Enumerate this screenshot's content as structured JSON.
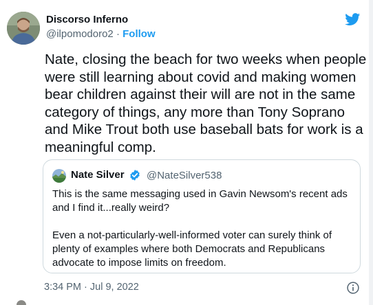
{
  "author": {
    "name": "Discorso Inferno",
    "handle": "@ilpomodoro2",
    "separator": "·",
    "follow_label": "Follow"
  },
  "tweet": {
    "text": "Nate, closing the beach for two weeks when people were still learning about covid and making women bear children against their will are not in the same category of things, any more than Tony Soprano and Mike Trout both use baseball bats for work is a meaningful comp."
  },
  "quoted": {
    "name": "Nate Silver",
    "handle": "@NateSilver538",
    "paragraph1": "This is the same messaging used in Gavin Newsom's recent ads and I find it...really weird?",
    "paragraph2": "Even a not-particularly-well-informed voter can surely think of plenty of examples where both Democrats and Republicans advocate to impose limits on freedom."
  },
  "footer": {
    "timestamp": "3:34 PM · Jul 9, 2022"
  },
  "colors": {
    "accent": "#1d9bf0",
    "secondary_text": "#536471",
    "border": "#cfd9de"
  },
  "icons": [
    "twitter-bird-icon",
    "verified-badge-icon",
    "info-icon"
  ]
}
